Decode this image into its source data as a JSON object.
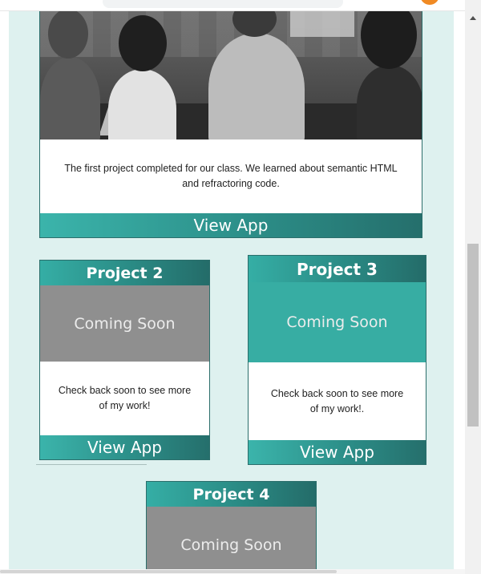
{
  "projects": [
    {
      "description": "The first project completed for our class. We learned about semantic HTML and refractoring code.",
      "button_label": "View App"
    },
    {
      "title": "Project 2",
      "placeholder": "Coming Soon",
      "description": "Check back soon to see more of my work!",
      "button_label": "View App"
    },
    {
      "title": "Project 3",
      "placeholder": "Coming Soon",
      "description": "Check back soon to see more of my work!.",
      "button_label": "View App"
    },
    {
      "title": "Project 4",
      "placeholder": "Coming Soon"
    }
  ],
  "colors": {
    "page_background": "#def1ef",
    "accent": "#35aea5",
    "placeholder_gray": "#8f8f8f",
    "placeholder_teal": "#37ada3"
  },
  "icons": {
    "scroll_up": "scroll-up-arrow-icon"
  }
}
